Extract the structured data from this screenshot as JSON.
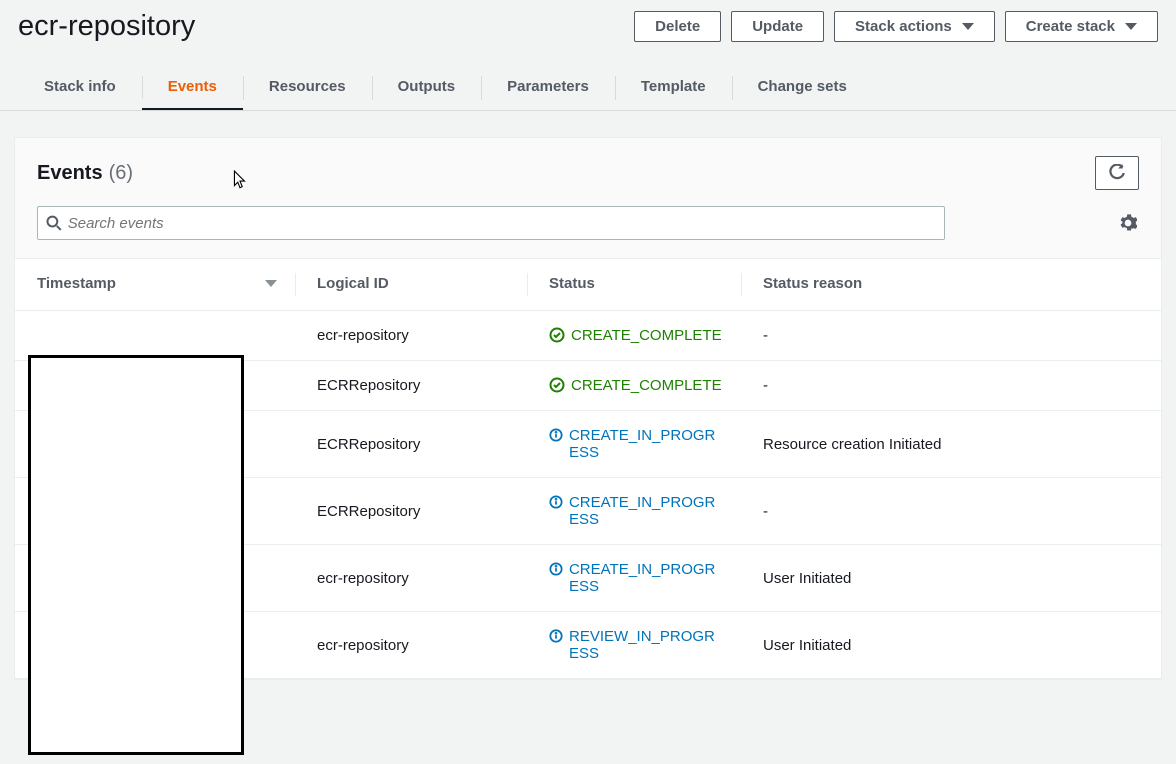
{
  "header": {
    "title": "ecr-repository",
    "buttons": {
      "delete": "Delete",
      "update": "Update",
      "stack_actions": "Stack actions",
      "create_stack": "Create stack"
    }
  },
  "tabs": [
    {
      "id": "stack-info",
      "label": "Stack info",
      "active": false
    },
    {
      "id": "events",
      "label": "Events",
      "active": true
    },
    {
      "id": "resources",
      "label": "Resources",
      "active": false
    },
    {
      "id": "outputs",
      "label": "Outputs",
      "active": false
    },
    {
      "id": "parameters",
      "label": "Parameters",
      "active": false
    },
    {
      "id": "template",
      "label": "Template",
      "active": false
    },
    {
      "id": "change-sets",
      "label": "Change sets",
      "active": false
    }
  ],
  "panel": {
    "title": "Events",
    "count": "(6)",
    "search_placeholder": "Search events"
  },
  "columns": {
    "timestamp": "Timestamp",
    "logical_id": "Logical ID",
    "status": "Status",
    "status_reason": "Status reason"
  },
  "rows": [
    {
      "timestamp": "",
      "logical_id": "ecr-repository",
      "status": "CREATE_COMPLETE",
      "status_kind": "complete",
      "reason": "-"
    },
    {
      "timestamp": "",
      "logical_id": "ECRRepository",
      "status": "CREATE_COMPLETE",
      "status_kind": "complete",
      "reason": "-"
    },
    {
      "timestamp": "",
      "logical_id": "ECRRepository",
      "status": "CREATE_IN_PROGRESS",
      "status_kind": "progress",
      "reason": "Resource creation Initiated"
    },
    {
      "timestamp": "",
      "logical_id": "ECRRepository",
      "status": "CREATE_IN_PROGRESS",
      "status_kind": "progress",
      "reason": "-"
    },
    {
      "timestamp": "",
      "logical_id": "ecr-repository",
      "status": "CREATE_IN_PROGRESS",
      "status_kind": "progress",
      "reason": "User Initiated"
    },
    {
      "timestamp": "",
      "logical_id": "ecr-repository",
      "status": "REVIEW_IN_PROGRESS",
      "status_kind": "progress",
      "reason": "User Initiated"
    }
  ]
}
